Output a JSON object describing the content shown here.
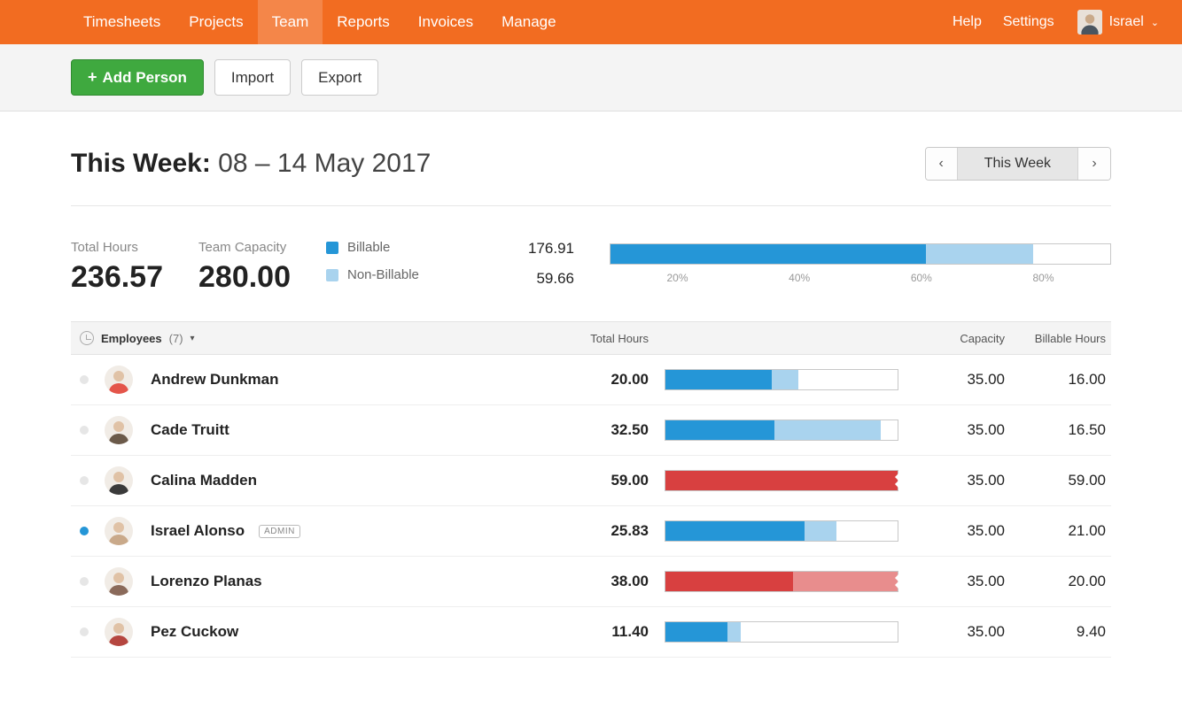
{
  "nav": {
    "items": [
      "Timesheets",
      "Projects",
      "Team",
      "Reports",
      "Invoices",
      "Manage"
    ],
    "active": "Team",
    "help": "Help",
    "settings": "Settings",
    "user": "Israel"
  },
  "toolbar": {
    "add": "Add Person",
    "import": "Import",
    "export": "Export"
  },
  "header": {
    "title_strong": "This Week:",
    "title_range": "08 – 14 May 2017",
    "period_label": "This Week"
  },
  "summary": {
    "total_label": "Total Hours",
    "total_value": "236.57",
    "capacity_label": "Team Capacity",
    "capacity_value": "280.00",
    "billable_label": "Billable",
    "nonbillable_label": "Non-Billable",
    "billable_value": "176.91",
    "nonbillable_value": "59.66",
    "ticks": [
      "20%",
      "40%",
      "60%",
      "80%"
    ]
  },
  "table": {
    "head_name": "Employees",
    "head_count": "(7)",
    "head_total": "Total Hours",
    "head_capacity": "Capacity",
    "head_billable": "Billable Hours",
    "rows": [
      {
        "name": "Andrew Dunkman",
        "total": "20.00",
        "capacity": "35.00",
        "billable": "16.00",
        "billable_pct": 45.7,
        "non_pct": 11.4,
        "over": false,
        "online": false,
        "admin": false
      },
      {
        "name": "Cade Truitt",
        "total": "32.50",
        "capacity": "35.00",
        "billable": "16.50",
        "billable_pct": 47.1,
        "non_pct": 45.7,
        "over": false,
        "online": false,
        "admin": false
      },
      {
        "name": "Calina Madden",
        "total": "59.00",
        "capacity": "35.00",
        "billable": "59.00",
        "billable_pct": 100,
        "non_pct": 0,
        "over": true,
        "online": false,
        "admin": false
      },
      {
        "name": "Israel Alonso",
        "total": "25.83",
        "capacity": "35.00",
        "billable": "21.00",
        "billable_pct": 60.0,
        "non_pct": 13.8,
        "over": false,
        "online": true,
        "admin": true
      },
      {
        "name": "Lorenzo Planas",
        "total": "38.00",
        "capacity": "35.00",
        "billable": "20.00",
        "billable_pct": 55,
        "non_pct": 45,
        "over": true,
        "online": false,
        "admin": false
      },
      {
        "name": "Pez Cuckow",
        "total": "11.40",
        "capacity": "35.00",
        "billable": "9.40",
        "billable_pct": 26.9,
        "non_pct": 5.7,
        "over": false,
        "online": false,
        "admin": false
      }
    ],
    "admin_badge": "ADMIN"
  },
  "colors": {
    "billable": "#2596d7",
    "nonbillable": "#a9d3ee",
    "over_primary": "#d84040",
    "over_secondary": "#e88d8d",
    "brand": "#f26c21",
    "primary_btn": "#3fa93f"
  },
  "chart_data": {
    "type": "bar",
    "title": "Team utilization vs capacity",
    "overall": {
      "capacity": 280.0,
      "billable": 176.91,
      "nonbillable": 59.66,
      "billable_pct": 63.2,
      "nonbillable_pct": 21.3
    },
    "categories": [
      "Andrew Dunkman",
      "Cade Truitt",
      "Calina Madden",
      "Israel Alonso",
      "Lorenzo Planas",
      "Pez Cuckow"
    ],
    "series": [
      {
        "name": "Billable Hours",
        "values": [
          16.0,
          16.5,
          59.0,
          21.0,
          20.0,
          9.4
        ]
      },
      {
        "name": "Non-Billable Hours",
        "values": [
          4.0,
          16.0,
          0.0,
          4.83,
          18.0,
          2.0
        ]
      },
      {
        "name": "Capacity",
        "values": [
          35.0,
          35.0,
          35.0,
          35.0,
          35.0,
          35.0
        ]
      }
    ],
    "xlabel": "",
    "ylabel": "Hours",
    "ylim": [
      0,
      60
    ]
  }
}
